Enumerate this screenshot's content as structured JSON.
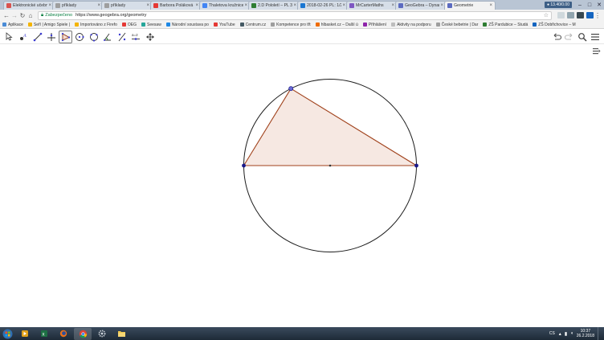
{
  "browser": {
    "tabs": [
      {
        "label": "Elektronické učebnice",
        "color": "#d9534f"
      },
      {
        "label": "příklady",
        "color": "#9e9e9e"
      },
      {
        "label": "příklady",
        "color": "#9e9e9e"
      },
      {
        "label": "Barbora Poláková -",
        "color": "#e53935"
      },
      {
        "label": "Thaletova kružnice",
        "color": "#4285f4"
      },
      {
        "label": "2.D Pololetí – PL 30.",
        "color": "#2e7d32"
      },
      {
        "label": "2018-02-26 PL: 1/2",
        "color": "#1976d2"
      },
      {
        "label": "MrCarterMaths",
        "color": "#7e57c2"
      },
      {
        "label": "GeoGebra – Dynam",
        "color": "#5c6bc0"
      },
      {
        "label": "Geometrie",
        "color": "#5c6bc0",
        "active": true
      }
    ],
    "window_user": "● 13.40/0.00",
    "secure_label": "Zabezpečeno",
    "url": "https://www.geogebra.org/geometry",
    "bookmarks": [
      {
        "label": "Aplikace",
        "color": "#4a8bd6"
      },
      {
        "label": "Seří | Amigo Spiele |",
        "color": "#f4b400"
      },
      {
        "label": "Importováno z Firefo",
        "color": "#f4b400"
      },
      {
        "label": "OEG",
        "color": "#e53935"
      },
      {
        "label": "Seesaw",
        "color": "#26a69a"
      },
      {
        "label": "Národní soustava po",
        "color": "#1e88e5"
      },
      {
        "label": "YouTube",
        "color": "#e53935"
      },
      {
        "label": "Centrum.cz",
        "color": "#455a64"
      },
      {
        "label": "Kompetence pro třt",
        "color": "#9e9e9e"
      },
      {
        "label": "hlbasket.cz – Další ú",
        "color": "#ef6c00"
      },
      {
        "label": "Přihlášení",
        "color": "#8e24aa"
      },
      {
        "label": "Aktivity na podporu",
        "color": "#bdbdbd"
      },
      {
        "label": "České bebetrie | Dar",
        "color": "#9e9e9e"
      },
      {
        "label": "ZŠ Pardubice – Studá",
        "color": "#2e7d32"
      },
      {
        "label": "ZŠ Dobřichovice – M",
        "color": "#1565c0"
      }
    ]
  },
  "geogebra": {
    "tools": [
      "move",
      "point",
      "segment",
      "perpendicular-line",
      "polygon",
      "circle-center-point",
      "circle-three-points",
      "angle",
      "reflect",
      "slider",
      "move-graphics"
    ],
    "selected_tool": "polygon",
    "colors": {
      "triangle_fill": "#f6e8e2",
      "triangle_edge": "#a0411b",
      "circle": "#1c1c1c",
      "point_dark": "#1a1a8c",
      "point_light": "#6b6bd6"
    }
  },
  "taskbar": {
    "language": "CS",
    "time": "10:37",
    "date": "26.2.2018"
  }
}
